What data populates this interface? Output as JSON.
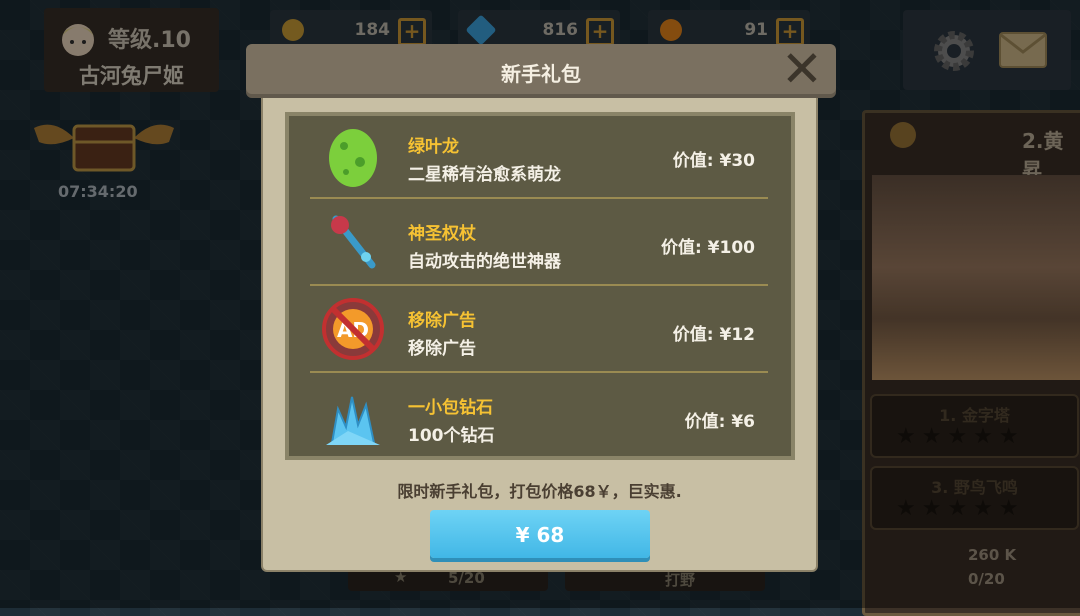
{
  "player": {
    "level": "等级.10",
    "name": "古河兔尸姬"
  },
  "resources": [
    {
      "icon": "gold-coin-icon",
      "value": "184",
      "plus": "+"
    },
    {
      "icon": "diamond-icon",
      "value": "816",
      "plus": "+"
    },
    {
      "icon": "orange-orb-icon",
      "value": "91",
      "plus": "+"
    }
  ],
  "chest": {
    "timer": "07:34:20"
  },
  "right_panel": {
    "title": "2.黄昇",
    "cards": [
      {
        "title": "1. 金字塔"
      },
      {
        "title": "3. 野鸟飞鸣"
      }
    ],
    "stars": "★★★★★",
    "gold": "260 K",
    "progress": "0/20"
  },
  "behind": {
    "left_progress": "5/20",
    "right_label": "打野"
  },
  "dialog": {
    "title": "新手礼包",
    "close": "✕",
    "items": [
      {
        "name": "绿叶龙",
        "desc": "二星稀有治愈系萌龙",
        "price": "价值: ¥30"
      },
      {
        "name": "神圣权杖",
        "desc": "自动攻击的绝世神器",
        "price": "价值: ¥100"
      },
      {
        "name": "移除广告",
        "desc": "移除广告",
        "price": "价值: ¥12",
        "ad": "AD"
      },
      {
        "name": "一小包钻石",
        "desc": "100个钻石",
        "price": "价值: ¥6"
      }
    ],
    "promo": "限时新手礼包，打包价格68￥，巨实惠.",
    "buy_label": "¥ 68"
  },
  "colors": {
    "accent_blue": "#41b7e6",
    "item_name": "#f6c233",
    "panel": "#5d5a44"
  }
}
